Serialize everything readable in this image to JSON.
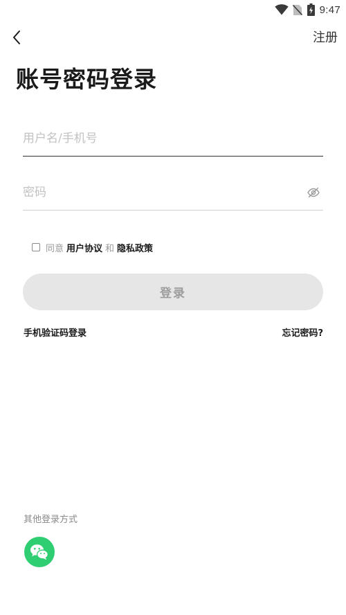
{
  "status_bar": {
    "time": "9:47",
    "icons": [
      "wifi-icon",
      "no-sim-icon",
      "battery-charging-icon"
    ]
  },
  "nav": {
    "back_icon": "chevron-left-icon",
    "register_label": "注册"
  },
  "title": "账号密码登录",
  "form": {
    "username_placeholder": "用户名/手机号",
    "username_value": "",
    "password_placeholder": "密码",
    "password_value": "",
    "password_toggle_icon": "eye-off-icon"
  },
  "agreement": {
    "checked": false,
    "prefix": "同意",
    "user_agreement": "用户协议",
    "conjunction": "和",
    "privacy_policy": "隐私政策"
  },
  "login_button_label": "登录",
  "links": {
    "sms_login": "手机验证码登录",
    "forgot_password": "忘记密码?"
  },
  "other_login": {
    "label": "其他登录方式",
    "wechat_icon": "wechat-icon"
  },
  "colors": {
    "wechat_green": "#2fce72",
    "button_disabled_bg": "#e6e6e6",
    "button_disabled_text": "#9d9d9d",
    "placeholder": "#c2c2c2"
  }
}
